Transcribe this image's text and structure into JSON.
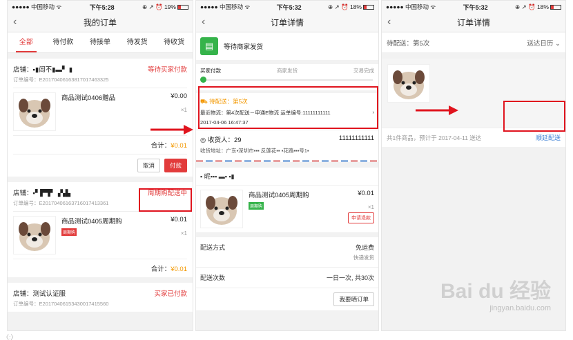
{
  "phone1": {
    "status": {
      "carrier": "●●●●● 中国移动 ᯤ",
      "time": "下午5:28",
      "right": "⊕ ↗ ⏰ 19%"
    },
    "nav_title": "我的订单",
    "tabs": [
      "全部",
      "待付款",
      "待接单",
      "待发货",
      "待收货"
    ],
    "orders": [
      {
        "shop": "店铺：▪▮闾不▮▬▘  ▮",
        "status": "等待买家付款",
        "no": "订单编号：E20170406163817017463325",
        "product": "商品测试0406赠品",
        "price": "¥0.00",
        "qty": "×1",
        "total_label": "合计：",
        "total": "¥0.01",
        "btn_cancel": "取消",
        "btn_pay": "付款"
      },
      {
        "shop": "店铺：▪▘▛▜▘▗▚▙",
        "status": "周期购配送中",
        "no": "订单编号：E20170406163716017413361",
        "product": "商品测试0405周期购",
        "price": "¥0.01",
        "qty": "×1",
        "tag": "周期购",
        "total_label": "合计：",
        "total": "¥0.01"
      },
      {
        "shop": "店铺：测试认证服",
        "status": "买家已付款",
        "no": "订单编号：E20170406153430017415560"
      }
    ]
  },
  "phone2": {
    "status": {
      "carrier": "●●●●● 中国移动 ᯤ",
      "time": "下午5:32",
      "right": "⊕ ↗ ⏰ 18%"
    },
    "nav_title": "订单详情",
    "wait_text": "等待商家发货",
    "steps": [
      "买家付款",
      "商家发货",
      "交易完成"
    ],
    "delivery": {
      "title": "待配送：第5次",
      "logistics": "最近物流：第4次配送－申通E物流 运单编号:11111111111",
      "time": "2017-04-06 16:47:37"
    },
    "address": {
      "name": "收货人：29",
      "phone": "11111111111",
      "line": "收货地址：广东▪深圳市▪▪▪ 反莲花▪▪ ▪花路▪▪▪号1▪"
    },
    "shop": "▪ 昵▪▪▪ ▬▪ ▪▮",
    "product": {
      "name": "商品测试0405周期购",
      "price": "¥0.01",
      "qty": "×1",
      "tag": "周期购",
      "refund": "申请退款"
    },
    "ship_method_label": "配送方式",
    "ship_method_value": "免运费",
    "ship_method_sub": "快递发货",
    "ship_count_label": "配送次数",
    "ship_count_value": "一日一次, 共30次",
    "review_btn": "我要晒订单"
  },
  "phone3": {
    "status": {
      "carrier": "●●●●● 中国移动 ᯤ",
      "time": "下午5:32",
      "right": "⊕ ↗ ⏰ 18%"
    },
    "nav_title": "订单详情",
    "pending": "待配送：第5次",
    "calendar": "送达日历 ⌄",
    "footer": "共1件商品，预计于 2017-04-11 送达",
    "delay": "顺延配送"
  },
  "watermark": "Bai du 经验",
  "watermark_url": "jingyan.baidu.com",
  "caption": "〈:〉"
}
